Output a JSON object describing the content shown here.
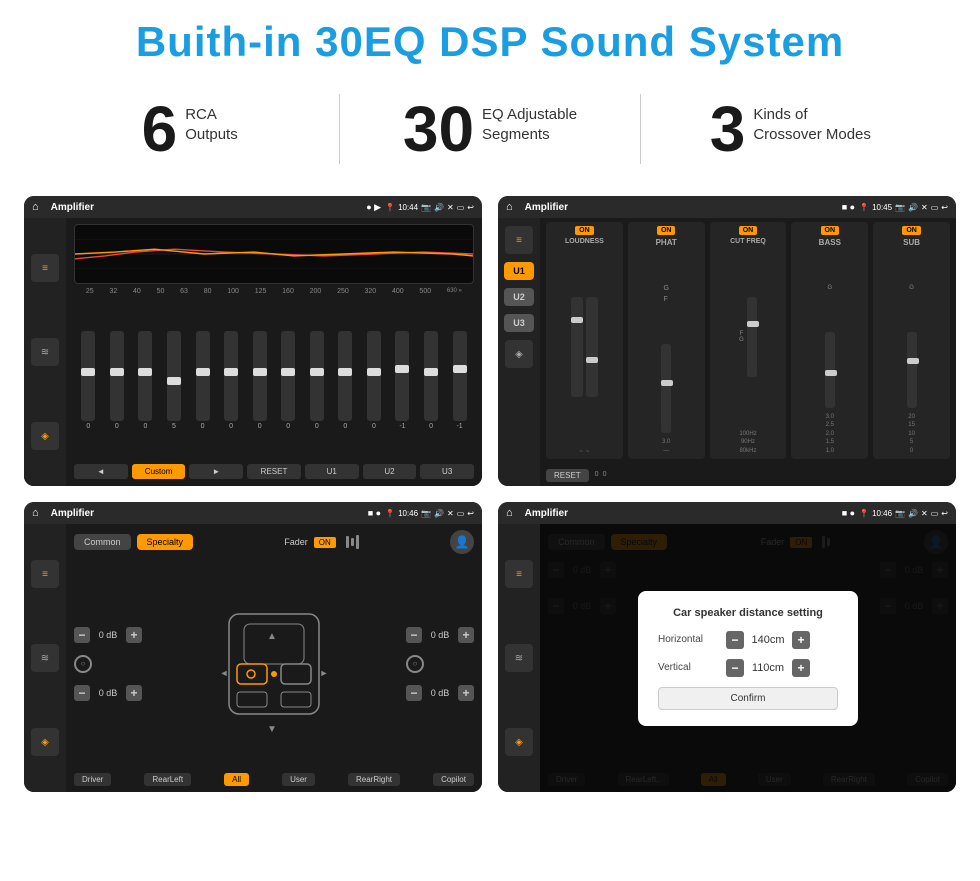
{
  "page": {
    "title": "Buith-in 30EQ DSP Sound System",
    "stats": [
      {
        "number": "6",
        "label": "RCA\nOutputs"
      },
      {
        "number": "30",
        "label": "EQ Adjustable\nSegments"
      },
      {
        "number": "3",
        "label": "Kinds of\nCrossover Modes"
      }
    ]
  },
  "screen1": {
    "statusBar": {
      "title": "Amplifier",
      "time": "10:44"
    },
    "freqLabels": [
      "25",
      "32",
      "40",
      "50",
      "63",
      "80",
      "100",
      "125",
      "160",
      "200",
      "250",
      "320",
      "400",
      "500",
      "630"
    ],
    "sliders": [
      {
        "val": "0",
        "pos": 50
      },
      {
        "val": "0",
        "pos": 50
      },
      {
        "val": "0",
        "pos": 50
      },
      {
        "val": "5",
        "pos": 40
      },
      {
        "val": "0",
        "pos": 50
      },
      {
        "val": "0",
        "pos": 50
      },
      {
        "val": "0",
        "pos": 50
      },
      {
        "val": "0",
        "pos": 50
      },
      {
        "val": "0",
        "pos": 50
      },
      {
        "val": "0",
        "pos": 50
      },
      {
        "val": "0",
        "pos": 50
      },
      {
        "val": "-1",
        "pos": 53
      },
      {
        "val": "0",
        "pos": 50
      },
      {
        "val": "-1",
        "pos": 53
      }
    ],
    "bottomBtns": [
      "◄",
      "Custom",
      "►",
      "RESET",
      "U1",
      "U2",
      "U3"
    ]
  },
  "screen2": {
    "statusBar": {
      "title": "Amplifier",
      "time": "10:45"
    },
    "uBtns": [
      "U1",
      "U2",
      "U3"
    ],
    "columns": [
      {
        "on": true,
        "label": "LOUDNESS"
      },
      {
        "on": true,
        "label": "PHAT"
      },
      {
        "on": true,
        "label": "CUT FREQ"
      },
      {
        "on": true,
        "label": "BASS"
      },
      {
        "on": true,
        "label": "SUB"
      }
    ],
    "resetBtn": "RESET"
  },
  "screen3": {
    "statusBar": {
      "title": "Amplifier",
      "time": "10:46"
    },
    "tabs": [
      "Common",
      "Specialty"
    ],
    "faderLabel": "Fader",
    "onLabel": "ON",
    "controls": {
      "topLeft": "0 dB",
      "topRight": "0 dB",
      "bottomLeft": "0 dB",
      "bottomRight": "0 dB"
    },
    "bottomBtns": [
      "Driver",
      "RearLeft",
      "All",
      "User",
      "RearRight",
      "Copilot"
    ]
  },
  "screen4": {
    "statusBar": {
      "title": "Amplifier",
      "time": "10:46"
    },
    "tabs": [
      "Common",
      "Specialty"
    ],
    "modal": {
      "title": "Car speaker distance setting",
      "rows": [
        {
          "label": "Horizontal",
          "value": "140cm"
        },
        {
          "label": "Vertical",
          "value": "110cm"
        }
      ],
      "confirmBtn": "Confirm"
    },
    "controls": {
      "topRight": "0 dB",
      "bottomRight": "0 dB"
    },
    "bottomBtns": [
      "Driver",
      "RearLeft..",
      "All",
      "User",
      "RearRight",
      "Copilot"
    ]
  }
}
